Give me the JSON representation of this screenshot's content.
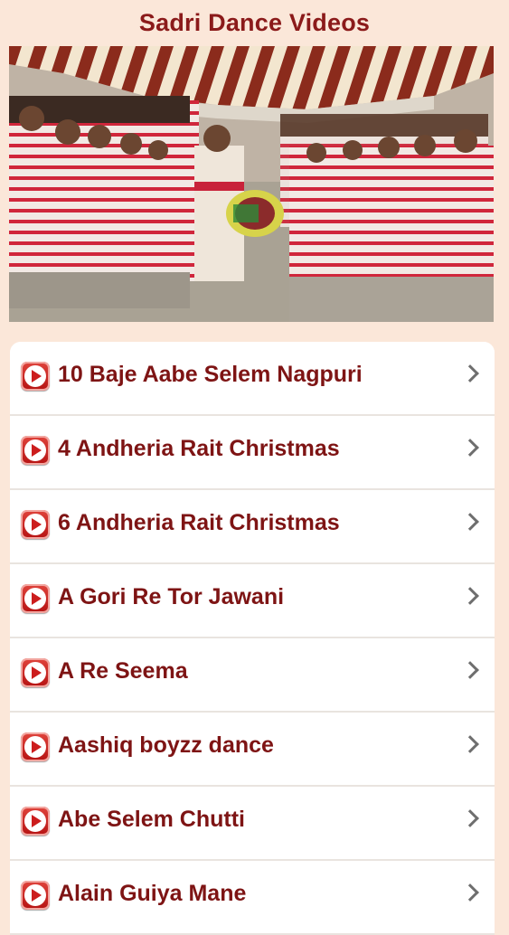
{
  "header": {
    "title": "Sadri Dance Videos"
  },
  "hero": {
    "icon": "dance-photo"
  },
  "list": {
    "items": [
      {
        "label": "10 Baje Aabe Selem Nagpuri"
      },
      {
        "label": "4 Andheria Rait Christmas"
      },
      {
        "label": "6 Andheria Rait Christmas"
      },
      {
        "label": "A Gori Re Tor Jawani"
      },
      {
        "label": "A Re Seema"
      },
      {
        "label": "Aashiq boyzz dance"
      },
      {
        "label": "Abe Selem Chutti"
      },
      {
        "label": "Alain Guiya Mane"
      }
    ]
  },
  "colors": {
    "background": "#fbe7d9",
    "title": "#8b1a1a",
    "item_text": "#7e1414",
    "play_icon": "#cc1d1d"
  }
}
